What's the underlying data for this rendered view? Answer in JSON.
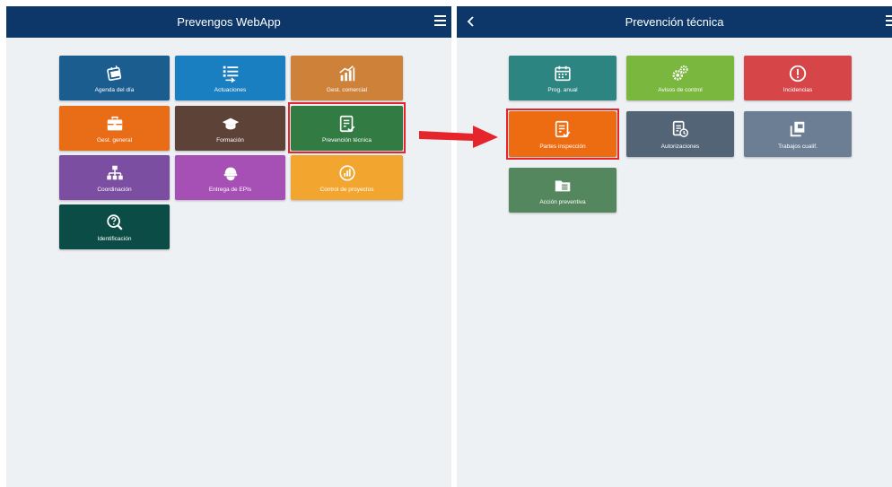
{
  "left": {
    "title": "Prevengos WebApp",
    "tiles": [
      {
        "label": "Agenda del día",
        "color": "#1c5d8f",
        "icon": "calendar-card-icon"
      },
      {
        "label": "Actuaciones",
        "color": "#1a7fc1",
        "icon": "checklist-icon"
      },
      {
        "label": "Gest. comercial",
        "color": "#ce8139",
        "icon": "growth-chart-icon"
      },
      {
        "label": "Gest. general",
        "color": "#e96d17",
        "icon": "briefcase-icon"
      },
      {
        "label": "Formación",
        "color": "#5d4238",
        "icon": "graduation-cap-icon"
      },
      {
        "label": "Prevención técnica",
        "color": "#327b43",
        "icon": "document-check-icon"
      },
      {
        "label": "Coordinación",
        "color": "#7b4ea2",
        "icon": "org-chart-icon"
      },
      {
        "label": "Entrega de EPIs",
        "color": "#a64fb5",
        "icon": "helmet-icon"
      },
      {
        "label": "Control de proyectos",
        "color": "#f2a630",
        "icon": "project-control-icon"
      },
      {
        "label": "Identificación",
        "color": "#0b4d46",
        "icon": "magnifier-question-icon"
      }
    ]
  },
  "right": {
    "title": "Prevención técnica",
    "tiles": [
      {
        "label": "Prog. anual",
        "color": "#2d8582",
        "icon": "calendar-icon"
      },
      {
        "label": "Avisos de control",
        "color": "#7ab73e",
        "icon": "gears-icon"
      },
      {
        "label": "Incidencias",
        "color": "#d64649",
        "icon": "alert-circle-icon"
      },
      {
        "label": "Partes inspección",
        "color": "#ee6c11",
        "icon": "document-check-icon"
      },
      {
        "label": "Autorizaciones",
        "color": "#546477",
        "icon": "document-clock-icon"
      },
      {
        "label": "Trabajos cualif.",
        "color": "#6b7e93",
        "icon": "layers-icon"
      },
      {
        "label": "Acción preventiva",
        "color": "#55875e",
        "icon": "folder-icon"
      }
    ]
  },
  "annotations": {
    "highlight_color": "#e5252b",
    "arrow_color": "#e5252b"
  }
}
